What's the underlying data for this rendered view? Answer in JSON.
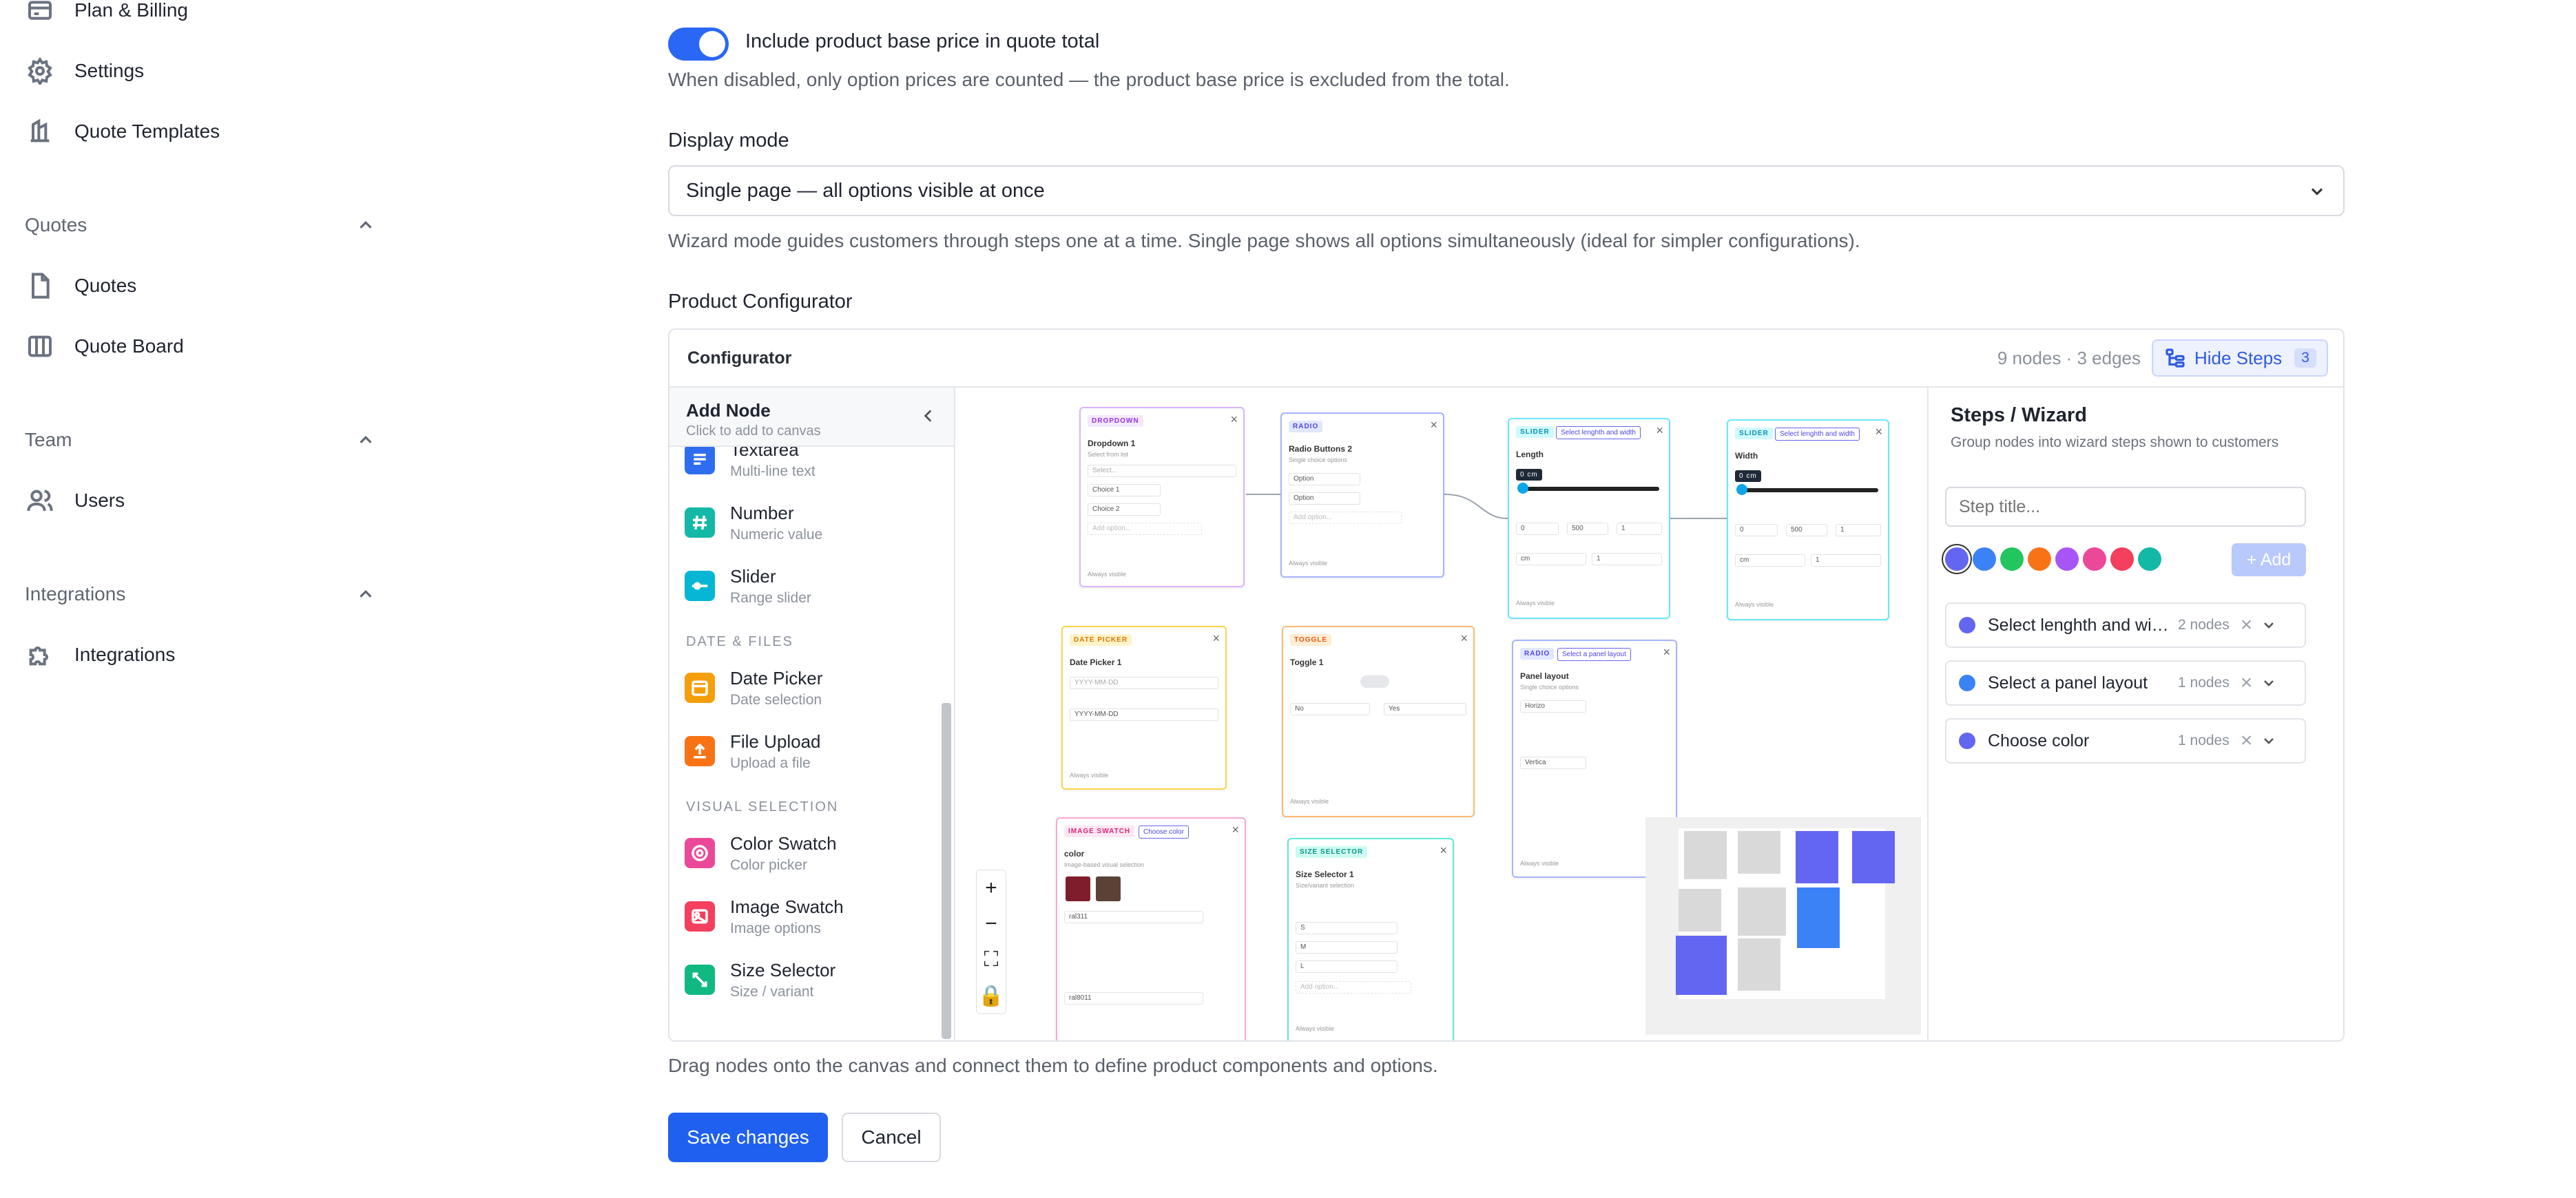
{
  "sidebar": {
    "items_top": [
      {
        "label": "Plan & Billing",
        "icon": "credit-card-icon"
      },
      {
        "label": "Settings",
        "icon": "gear-icon"
      },
      {
        "label": "Quote Templates",
        "icon": "template-icon"
      }
    ],
    "sections": [
      {
        "title": "Quotes",
        "items": [
          {
            "label": "Quotes",
            "icon": "document-icon"
          },
          {
            "label": "Quote Board",
            "icon": "board-icon"
          }
        ]
      },
      {
        "title": "Team",
        "items": [
          {
            "label": "Users",
            "icon": "users-icon"
          }
        ]
      },
      {
        "title": "Integrations",
        "items": [
          {
            "label": "Integrations",
            "icon": "puzzle-icon"
          }
        ]
      }
    ]
  },
  "main": {
    "toggle_label": "Include product base price in quote total",
    "toggle_on": true,
    "toggle_hint": "When disabled, only option prices are counted — the product base price is excluded from the total.",
    "display_mode_label": "Display mode",
    "display_mode_value": "Single page — all options visible at once",
    "display_mode_hint": "Wizard mode guides customers through steps one at a time. Single page shows all options simultaneously (ideal for simpler configurations).",
    "configurator_section_label": "Product Configurator",
    "configurator_hint": "Drag nodes onto the canvas and connect them to define product components and options.",
    "save_label": "Save changes",
    "cancel_label": "Cancel"
  },
  "configurator": {
    "title": "Configurator",
    "stats": "9 nodes · 3 edges",
    "hide_steps_label": "Hide Steps",
    "hide_steps_count": "3",
    "add_node": {
      "title": "Add Node",
      "subtitle": "Click to add to canvas",
      "items": [
        {
          "name": "Textarea",
          "desc": "Multi-line text",
          "color": "#2f6df0"
        },
        {
          "name": "Number",
          "desc": "Numeric value",
          "color": "#14b8a6"
        },
        {
          "name": "Slider",
          "desc": "Range slider",
          "color": "#06b6d4"
        },
        {
          "name": "Date Picker",
          "desc": "Date selection",
          "color": "#f59e0b"
        },
        {
          "name": "File Upload",
          "desc": "Upload a file",
          "color": "#f97316"
        },
        {
          "name": "Color Swatch",
          "desc": "Color picker",
          "color": "#ec4899"
        },
        {
          "name": "Image Swatch",
          "desc": "Image options",
          "color": "#f43f5e"
        },
        {
          "name": "Size Selector",
          "desc": "Size / variant",
          "color": "#10b981"
        }
      ],
      "categories": [
        "DATE & FILES",
        "VISUAL SELECTION"
      ]
    },
    "nodes": [
      {
        "tag": "DROPDOWN",
        "title": "Dropdown 1",
        "sub": "Select from list",
        "color": "#c084fc",
        "rows": [
          "Select...",
          "Choice 1",
          "Choice 2",
          "Add option..."
        ],
        "foot": "Always visible"
      },
      {
        "tag": "RADIO",
        "title": "Radio Buttons 2",
        "sub": "Single choice options",
        "color": "#818cf8",
        "rows": [
          "Option",
          "Option",
          "Add option..."
        ],
        "foot": "Always visible"
      },
      {
        "tag": "SLIDER",
        "badge": "Select lenghth and width",
        "title": "Length",
        "sub": "",
        "color": "#22d3ee",
        "rows": [
          "0",
          "500",
          "1",
          "cm",
          "1"
        ],
        "foot": "Always visible",
        "chip": "0 cm"
      },
      {
        "tag": "SLIDER",
        "badge": "Select lenghth and width",
        "title": "Width",
        "sub": "",
        "color": "#22d3ee",
        "rows": [
          "0",
          "500",
          "1",
          "cm",
          "1"
        ],
        "foot": "Always visible",
        "chip": "0 cm"
      },
      {
        "tag": "DATE PICKER",
        "title": "Date Picker 1",
        "sub": "",
        "color": "#fbbf24",
        "rows": [
          "YYYY-MM-DD",
          "YYYY-MM-DD"
        ],
        "foot": "Always visible"
      },
      {
        "tag": "TOGGLE",
        "title": "Toggle 1",
        "sub": "",
        "color": "#fb923c",
        "rows": [
          "No",
          "Yes"
        ],
        "foot": "Always visible"
      },
      {
        "tag": "RADIO",
        "badge": "Select a panel layout",
        "title": "Panel layout",
        "sub": "Single choice options",
        "color": "#818cf8",
        "rows": [
          "Horizo",
          "Vertica"
        ],
        "foot": "Always visible"
      },
      {
        "tag": "IMAGE SWATCH",
        "badge": "Choose color",
        "title": "color",
        "sub": "Image-based visual selection",
        "color": "#f472b6",
        "rows": [
          "ral311",
          "ral8011"
        ],
        "foot": ""
      },
      {
        "tag": "SIZE SELECTOR",
        "title": "Size Selector 1",
        "sub": "Size/variant selection",
        "color": "#2dd4bf",
        "rows": [
          "S",
          "M",
          "L",
          "Add option..."
        ],
        "foot": "Always visible"
      }
    ],
    "steps": {
      "title": "Steps / Wizard",
      "subtitle": "Group nodes into wizard steps shown to customers",
      "input_placeholder": "Step title...",
      "add_label": "+ Add",
      "palette": [
        "#6366f1",
        "#3b82f6",
        "#22c55e",
        "#f97316",
        "#a855f7",
        "#ec4899",
        "#f43f5e",
        "#14b8a6"
      ],
      "list": [
        {
          "name": "Select lenghth and width",
          "count": "2 nodes",
          "color": "#6366f1"
        },
        {
          "name": "Select a panel layout",
          "count": "1 nodes",
          "color": "#3b82f6"
        },
        {
          "name": "Choose color",
          "count": "1 nodes",
          "color": "#6366f1"
        }
      ]
    }
  }
}
